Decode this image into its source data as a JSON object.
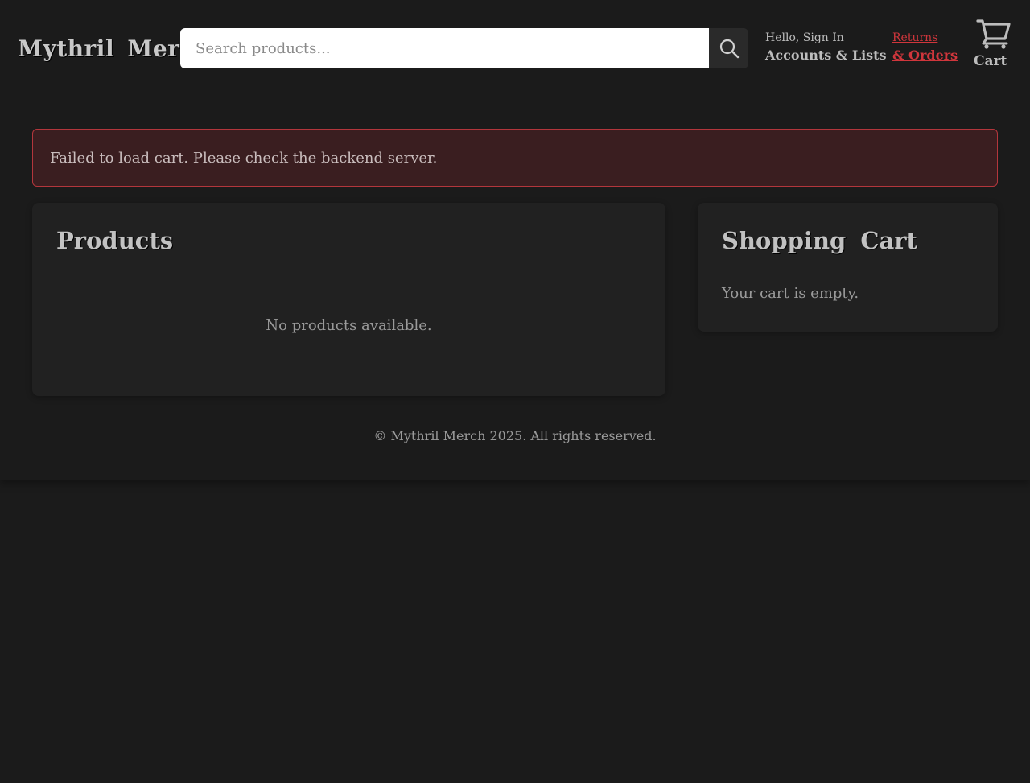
{
  "header": {
    "logo_text": "Mythril Merch",
    "search": {
      "placeholder": "Search products...",
      "value": "",
      "button_icon": "search-icon"
    },
    "account": {
      "greeting": "Hello, Sign In",
      "label": "Accounts & Lists"
    },
    "returns": {
      "top": "Returns",
      "bottom": "& Orders"
    },
    "cart": {
      "icon": "cart-icon",
      "label": "Cart"
    }
  },
  "error_banner": {
    "message": "Failed to load cart. Please check the backend server."
  },
  "products_panel": {
    "title": "Products",
    "empty_message": "No products available."
  },
  "cart_panel": {
    "title": "Shopping Cart",
    "empty_message": "Your cart is empty."
  },
  "footer": {
    "text": "© Mythril Merch 2025. All rights reserved."
  },
  "colors": {
    "background": "#1b1b1b",
    "panel": "#212121",
    "accent_red": "#d0363c",
    "error_bg": "#3a1e20",
    "error_border": "#b3363c",
    "text": "#bdbdbd"
  }
}
